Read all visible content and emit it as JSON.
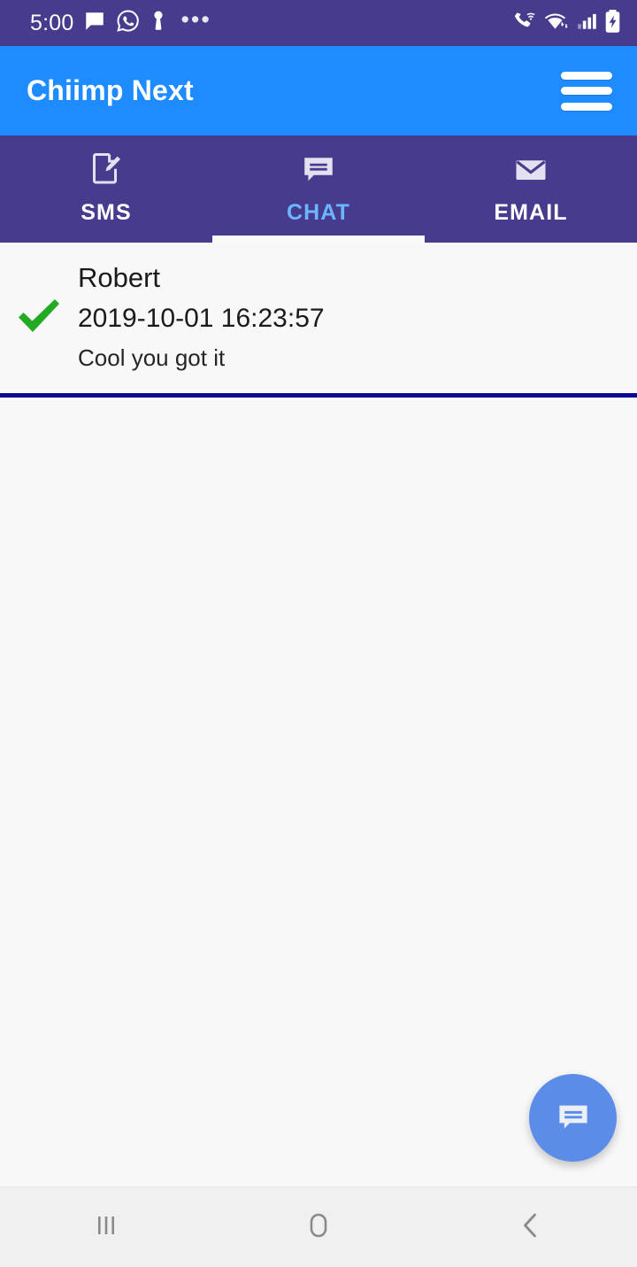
{
  "status_bar": {
    "time": "5:00",
    "left_icons": [
      "message-bubble-icon",
      "whatsapp-icon",
      "person-icon",
      "more-dots-icon"
    ],
    "right_icons": [
      "phone-wifi-calling-icon",
      "wifi-icon",
      "cellular-signal-icon",
      "battery-charging-icon"
    ],
    "background_color": "#473b8e"
  },
  "app_bar": {
    "title": "Chiimp Next",
    "menu_icon": "hamburger-menu-icon",
    "background_color": "#1e8bff"
  },
  "tabs": {
    "active_index": 1,
    "background_color": "#473b8e",
    "active_color": "#6bb6ff",
    "items": [
      {
        "label": "SMS",
        "icon": "compose-document-icon"
      },
      {
        "label": "CHAT",
        "icon": "chat-bubble-icon"
      },
      {
        "label": "EMAIL",
        "icon": "envelope-icon"
      }
    ]
  },
  "conversation_list": {
    "divider_color": "#0a0a96",
    "items": [
      {
        "status_icon": "green-check-icon",
        "status_color": "#22ab22",
        "name": "Robert",
        "timestamp": "2019-10-01 16:23:57",
        "message": "Cool you got it"
      }
    ]
  },
  "fab": {
    "icon": "chat-bubble-icon",
    "color": "#5b8de8"
  },
  "nav_bar": {
    "background_color": "#f0f0f0",
    "buttons": [
      {
        "name": "recents",
        "icon": "recents-icon"
      },
      {
        "name": "home",
        "icon": "home-icon"
      },
      {
        "name": "back",
        "icon": "back-chevron-icon"
      }
    ]
  }
}
